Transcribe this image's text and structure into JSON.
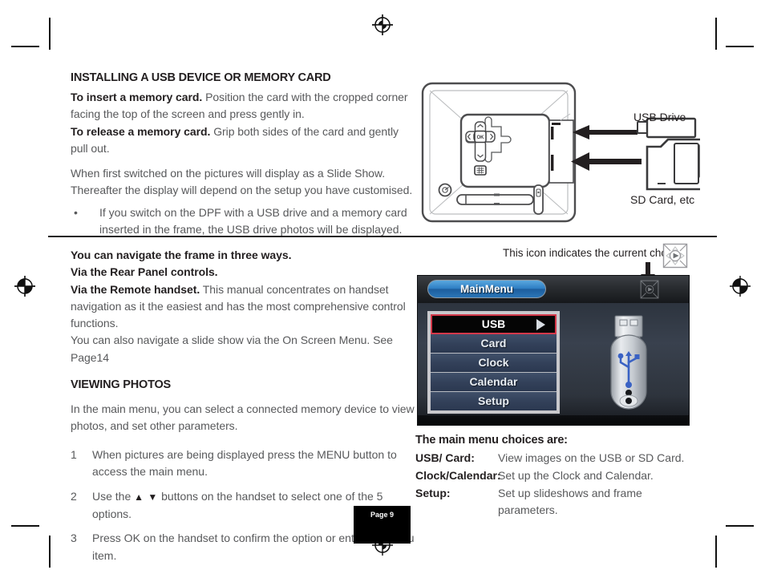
{
  "page": {
    "number_label": "Page 9"
  },
  "section_install": {
    "heading": "INSTALLING A USB DEVICE OR MEMORY CARD",
    "insert_lead": "To insert a memory card.",
    "insert_body": " Position the card with the cropped corner facing the top of the screen and press gently in.",
    "release_lead": "To release a memory card.",
    "release_body": " Grip both sides of the card and gently pull out.",
    "slideshow_note": "When first switched on the pictures will display as a Slide Show.  Thereafter the display will depend on the setup you have customised.",
    "bullet_dot": "•",
    "bullet_text": "If you switch on the DPF with a USB drive and a memory card inserted in the frame, the USB drive photos will be displayed."
  },
  "diagram": {
    "usb_drive_label": "USB Drive",
    "sd_card_label": "SD Card, etc",
    "ok_button_label": "OK"
  },
  "section_navigate": {
    "line1": "You can navigate the frame in three ways.",
    "line2": "Via the Rear Panel controls.",
    "line3_lead": "Via the Remote handset.",
    "line3_body": " This manual concentrates on handset navigation as it the easiest and has the most comprehensive control functions.",
    "line4": "You can also navigate a slide show via the On Screen Menu. See Page14"
  },
  "section_viewing": {
    "heading": "VIEWING PHOTOS",
    "intro": "In the main menu, you can select a connected memory device to view photos, and set other parameters.",
    "steps": [
      {
        "index": "1",
        "pre": "When pictures are being displayed press the MENU button to access the main menu.",
        "glyphs": "",
        "post": ""
      },
      {
        "index": "2",
        "pre": "Use the ",
        "glyphs": "▲ ▼",
        "post": " buttons on the handset to select one of the 5 options."
      },
      {
        "index": "3",
        "pre": "Press OK on the handset to confirm the option or enter the menu item.",
        "glyphs": "",
        "post": ""
      }
    ]
  },
  "icon_hint": {
    "text": "This icon indicates the current choice"
  },
  "screenshot": {
    "tab_label": "MainMenu",
    "menu_items": [
      {
        "label": "USB",
        "selected": true
      },
      {
        "label": "Card",
        "selected": false
      },
      {
        "label": "Clock",
        "selected": false
      },
      {
        "label": "Calendar",
        "selected": false
      },
      {
        "label": "Setup",
        "selected": false
      }
    ]
  },
  "section_choices": {
    "heading": "The main menu choices are:",
    "rows": [
      {
        "key": "USB/ Card:",
        "value": "View images on the USB or SD Card."
      },
      {
        "key": "Clock/Calendar:",
        "value": "Set up the Clock and Calendar."
      },
      {
        "key": "Setup:",
        "value": "Set up slideshows and frame parameters."
      }
    ]
  },
  "colors": {
    "accent_red": "#d4384a",
    "tab_blue": "#2f7fc4",
    "usb_symbol_blue": "#3060c0",
    "body_grey": "#58595b",
    "ink": "#231f20"
  }
}
